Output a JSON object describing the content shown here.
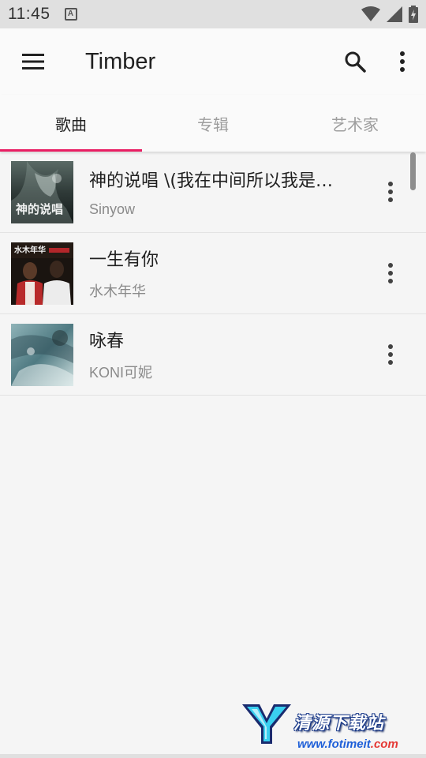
{
  "status_bar": {
    "time": "11:45",
    "notification_icon": "A"
  },
  "app_bar": {
    "title": "Timber",
    "menu_icon": "hamburger-menu-icon",
    "search_icon": "search-icon",
    "overflow_icon": "more-vert-icon"
  },
  "tabs": [
    {
      "label": "歌曲",
      "active": true
    },
    {
      "label": "专辑",
      "active": false
    },
    {
      "label": "艺术家",
      "active": false
    }
  ],
  "accent_color": "#e91e63",
  "songs": [
    {
      "title": "神的说唱 \\(我在中间所以我是…",
      "artist": "Sinyow",
      "art_text": "神的说唱"
    },
    {
      "title": "一生有你",
      "artist": "水木年华",
      "art_text": "水木年华"
    },
    {
      "title": "咏春",
      "artist": "KONI可妮",
      "art_text": ""
    }
  ],
  "watermark": {
    "brand": "清源下载站",
    "url_prefix": "www.fotimeit",
    "url_suffix": ".com"
  }
}
